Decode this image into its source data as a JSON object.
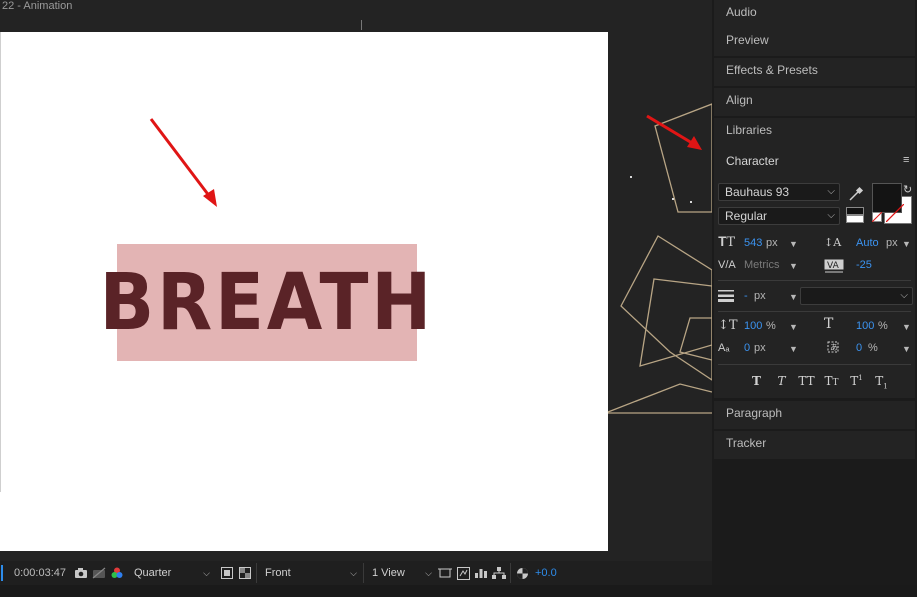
{
  "viewer": {
    "title": "22 - Animation",
    "breath_text": "BREATH"
  },
  "toolbar": {
    "timecode": "0:00:03:47",
    "resolution": "Quarter",
    "view": "Front",
    "layout": "1 View",
    "exposure": "+0.0"
  },
  "panels": {
    "audio": "Audio",
    "preview": "Preview",
    "effects": "Effects & Presets",
    "align": "Align",
    "libraries": "Libraries",
    "character": "Character",
    "paragraph": "Paragraph",
    "tracker": "Tracker"
  },
  "character": {
    "font": "Bauhaus 93",
    "style": "Regular",
    "size_value": "543",
    "size_unit": "px",
    "leading_value": "Auto",
    "leading_unit": "px",
    "kerning_value": "Metrics",
    "tracking_value": "-25",
    "stroke_value": "-",
    "stroke_unit": "px",
    "vscale_value": "100",
    "vscale_unit": "%",
    "hscale_value": "100",
    "hscale_unit": "%",
    "baseline_value": "0",
    "baseline_unit": "px",
    "tsume_value": "0",
    "tsume_unit": "%"
  },
  "colors": {
    "accent": "#2d8ceb",
    "artboard": "#ffffff",
    "text_box": "#e3b4b4",
    "text_color": "#5a2327",
    "annotation_arrow": "#e01515",
    "frame_lines": "#b8a585"
  }
}
